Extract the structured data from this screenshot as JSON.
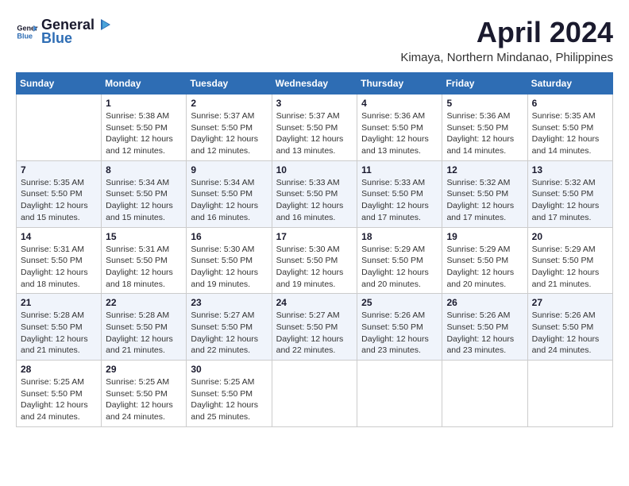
{
  "logo": {
    "line1": "General",
    "line2": "Blue"
  },
  "title": "April 2024",
  "subtitle": "Kimaya, Northern Mindanao, Philippines",
  "weekdays": [
    "Sunday",
    "Monday",
    "Tuesday",
    "Wednesday",
    "Thursday",
    "Friday",
    "Saturday"
  ],
  "weeks": [
    [
      {
        "day": "",
        "info": ""
      },
      {
        "day": "1",
        "info": "Sunrise: 5:38 AM\nSunset: 5:50 PM\nDaylight: 12 hours\nand 12 minutes."
      },
      {
        "day": "2",
        "info": "Sunrise: 5:37 AM\nSunset: 5:50 PM\nDaylight: 12 hours\nand 12 minutes."
      },
      {
        "day": "3",
        "info": "Sunrise: 5:37 AM\nSunset: 5:50 PM\nDaylight: 12 hours\nand 13 minutes."
      },
      {
        "day": "4",
        "info": "Sunrise: 5:36 AM\nSunset: 5:50 PM\nDaylight: 12 hours\nand 13 minutes."
      },
      {
        "day": "5",
        "info": "Sunrise: 5:36 AM\nSunset: 5:50 PM\nDaylight: 12 hours\nand 14 minutes."
      },
      {
        "day": "6",
        "info": "Sunrise: 5:35 AM\nSunset: 5:50 PM\nDaylight: 12 hours\nand 14 minutes."
      }
    ],
    [
      {
        "day": "7",
        "info": "Sunrise: 5:35 AM\nSunset: 5:50 PM\nDaylight: 12 hours\nand 15 minutes."
      },
      {
        "day": "8",
        "info": "Sunrise: 5:34 AM\nSunset: 5:50 PM\nDaylight: 12 hours\nand 15 minutes."
      },
      {
        "day": "9",
        "info": "Sunrise: 5:34 AM\nSunset: 5:50 PM\nDaylight: 12 hours\nand 16 minutes."
      },
      {
        "day": "10",
        "info": "Sunrise: 5:33 AM\nSunset: 5:50 PM\nDaylight: 12 hours\nand 16 minutes."
      },
      {
        "day": "11",
        "info": "Sunrise: 5:33 AM\nSunset: 5:50 PM\nDaylight: 12 hours\nand 17 minutes."
      },
      {
        "day": "12",
        "info": "Sunrise: 5:32 AM\nSunset: 5:50 PM\nDaylight: 12 hours\nand 17 minutes."
      },
      {
        "day": "13",
        "info": "Sunrise: 5:32 AM\nSunset: 5:50 PM\nDaylight: 12 hours\nand 17 minutes."
      }
    ],
    [
      {
        "day": "14",
        "info": "Sunrise: 5:31 AM\nSunset: 5:50 PM\nDaylight: 12 hours\nand 18 minutes."
      },
      {
        "day": "15",
        "info": "Sunrise: 5:31 AM\nSunset: 5:50 PM\nDaylight: 12 hours\nand 18 minutes."
      },
      {
        "day": "16",
        "info": "Sunrise: 5:30 AM\nSunset: 5:50 PM\nDaylight: 12 hours\nand 19 minutes."
      },
      {
        "day": "17",
        "info": "Sunrise: 5:30 AM\nSunset: 5:50 PM\nDaylight: 12 hours\nand 19 minutes."
      },
      {
        "day": "18",
        "info": "Sunrise: 5:29 AM\nSunset: 5:50 PM\nDaylight: 12 hours\nand 20 minutes."
      },
      {
        "day": "19",
        "info": "Sunrise: 5:29 AM\nSunset: 5:50 PM\nDaylight: 12 hours\nand 20 minutes."
      },
      {
        "day": "20",
        "info": "Sunrise: 5:29 AM\nSunset: 5:50 PM\nDaylight: 12 hours\nand 21 minutes."
      }
    ],
    [
      {
        "day": "21",
        "info": "Sunrise: 5:28 AM\nSunset: 5:50 PM\nDaylight: 12 hours\nand 21 minutes."
      },
      {
        "day": "22",
        "info": "Sunrise: 5:28 AM\nSunset: 5:50 PM\nDaylight: 12 hours\nand 21 minutes."
      },
      {
        "day": "23",
        "info": "Sunrise: 5:27 AM\nSunset: 5:50 PM\nDaylight: 12 hours\nand 22 minutes."
      },
      {
        "day": "24",
        "info": "Sunrise: 5:27 AM\nSunset: 5:50 PM\nDaylight: 12 hours\nand 22 minutes."
      },
      {
        "day": "25",
        "info": "Sunrise: 5:26 AM\nSunset: 5:50 PM\nDaylight: 12 hours\nand 23 minutes."
      },
      {
        "day": "26",
        "info": "Sunrise: 5:26 AM\nSunset: 5:50 PM\nDaylight: 12 hours\nand 23 minutes."
      },
      {
        "day": "27",
        "info": "Sunrise: 5:26 AM\nSunset: 5:50 PM\nDaylight: 12 hours\nand 24 minutes."
      }
    ],
    [
      {
        "day": "28",
        "info": "Sunrise: 5:25 AM\nSunset: 5:50 PM\nDaylight: 12 hours\nand 24 minutes."
      },
      {
        "day": "29",
        "info": "Sunrise: 5:25 AM\nSunset: 5:50 PM\nDaylight: 12 hours\nand 24 minutes."
      },
      {
        "day": "30",
        "info": "Sunrise: 5:25 AM\nSunset: 5:50 PM\nDaylight: 12 hours\nand 25 minutes."
      },
      {
        "day": "",
        "info": ""
      },
      {
        "day": "",
        "info": ""
      },
      {
        "day": "",
        "info": ""
      },
      {
        "day": "",
        "info": ""
      }
    ]
  ]
}
